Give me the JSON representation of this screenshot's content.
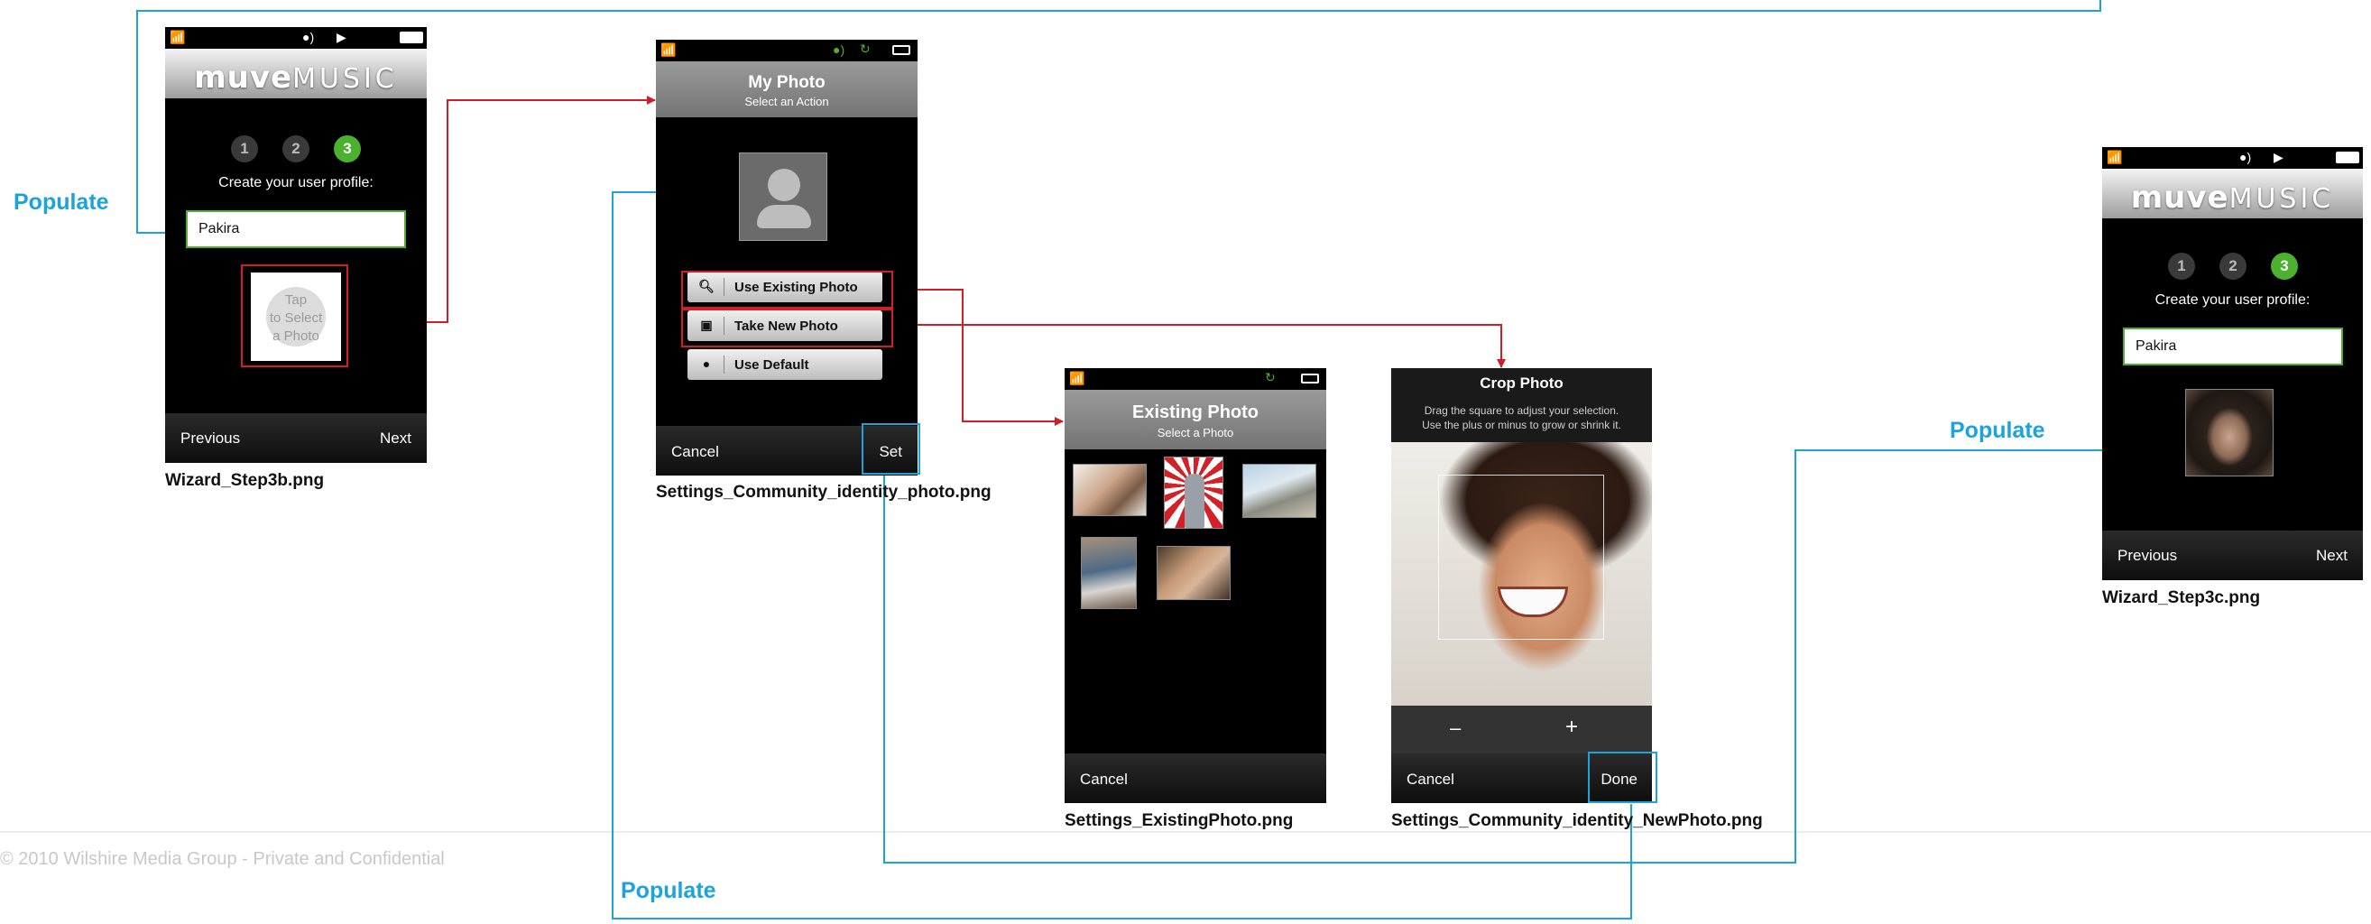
{
  "footer": {
    "copyright": "© 2010 Wilshire Media Group - Private and Confidential"
  },
  "populate_labels": [
    "Populate",
    "Populate",
    "Populate"
  ],
  "colors": {
    "blue_connector": "#1ca3dc",
    "red_connector": "#d21f26",
    "muve_green": "#4bb12f"
  },
  "screens": {
    "wizard_step3b": {
      "caption": "Wizard_Step3b.png",
      "logo_bold": "muve",
      "logo_light": "MUSIC",
      "steps": [
        "1",
        "2",
        "3"
      ],
      "active_step": 3,
      "prompt": "Create your user profile:",
      "name_value": "Pakira",
      "photo_placeholder": [
        "Tap",
        "to Select",
        "a Photo"
      ],
      "previous_label": "Previous",
      "next_label": "Next"
    },
    "identity_photo": {
      "caption": "Settings_Community_identity_photo.png",
      "title": "My Photo",
      "subtitle": "Select an Action",
      "actions": [
        {
          "label": "Use Existing Photo",
          "icon": "search-icon"
        },
        {
          "label": "Take New Photo",
          "icon": "camera-icon"
        },
        {
          "label": "Use Default",
          "icon": "person-icon"
        }
      ],
      "cancel_label": "Cancel",
      "set_label": "Set"
    },
    "existing_photo": {
      "caption": "Settings_ExistingPhoto.png",
      "title": "Existing Photo",
      "subtitle": "Select a Photo",
      "cancel_label": "Cancel"
    },
    "new_photo": {
      "caption": "Settings_Community_identity_NewPhoto.png",
      "title": "Crop Photo",
      "instructions": [
        "Drag the square to adjust your selection.",
        "Use the plus or minus to grow or shrink it."
      ],
      "minus_label": "–",
      "plus_label": "+",
      "cancel_label": "Cancel",
      "done_label": "Done"
    },
    "wizard_step3c": {
      "caption": "Wizard_Step3c.png",
      "logo_bold": "muve",
      "logo_light": "MUSIC",
      "steps": [
        "1",
        "2",
        "3"
      ],
      "active_step": 3,
      "prompt": "Create your user profile:",
      "name_value": "Pakira",
      "previous_label": "Previous",
      "next_label": "Next"
    }
  }
}
